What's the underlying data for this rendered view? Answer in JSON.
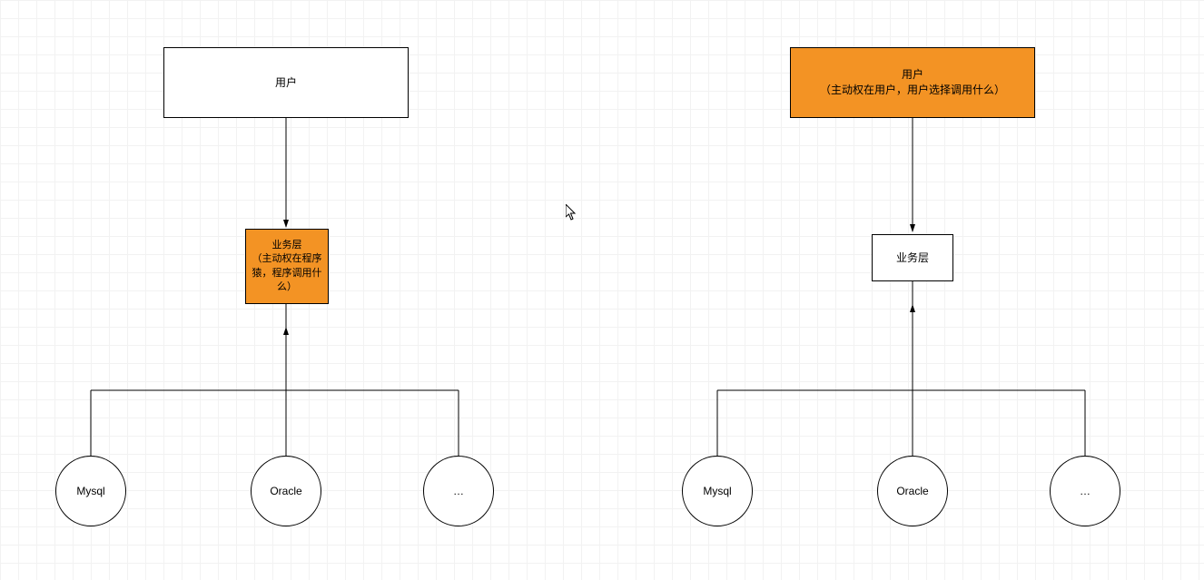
{
  "left": {
    "user": {
      "label": "用户"
    },
    "business": {
      "label": "业务层\n（主动权在程序猿，程序调用什么）"
    },
    "db1": {
      "label": "Mysql"
    },
    "db2": {
      "label": "Oracle"
    },
    "db3": {
      "label": "…"
    }
  },
  "right": {
    "user": {
      "label": "用户\n（主动权在用户，用户选择调用什么）"
    },
    "business": {
      "label": "业务层"
    },
    "db1": {
      "label": "Mysql"
    },
    "db2": {
      "label": "Oracle"
    },
    "db3": {
      "label": "…"
    }
  },
  "colors": {
    "highlight": "#F39324"
  }
}
